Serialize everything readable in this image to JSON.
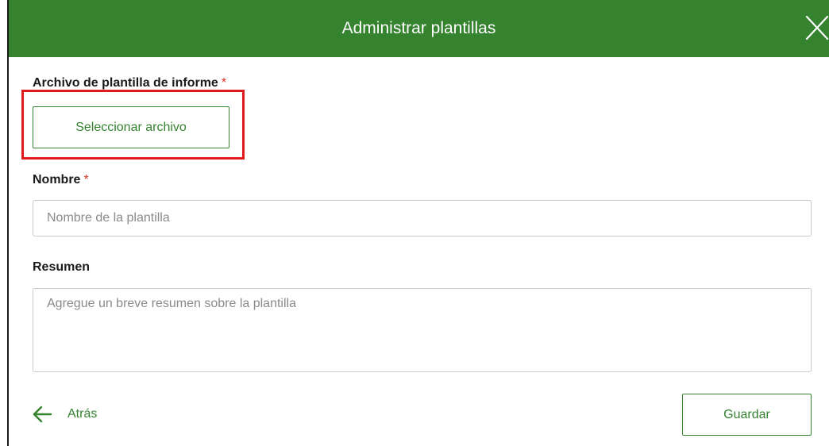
{
  "dialog": {
    "title": "Administrar plantillas",
    "close_icon": "close-icon"
  },
  "template_file": {
    "label": "Archivo de plantilla de informe",
    "required_mark": "*",
    "select_button_label": "Seleccionar archivo"
  },
  "name_field": {
    "label": "Nombre",
    "required_mark": "*",
    "placeholder": "Nombre de la plantilla"
  },
  "summary_field": {
    "label": "Resumen",
    "placeholder": "Agregue un breve resumen sobre la plantilla"
  },
  "footer": {
    "back_label": "Atrás",
    "back_icon": "arrow-left-icon",
    "save_label": "Guardar"
  },
  "colors": {
    "brand_green": "#35822f",
    "required_red": "#d83020",
    "highlight_red": "#e01b1b"
  }
}
